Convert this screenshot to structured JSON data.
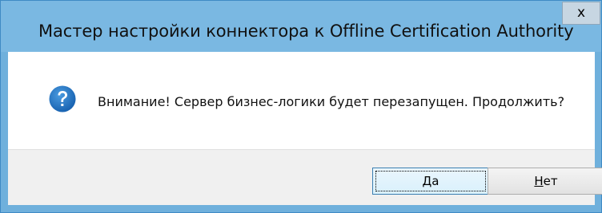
{
  "dialog": {
    "title": "Мастер настройки коннектора к Offline Certification Authority",
    "close_glyph": "x",
    "message": "Внимание! Сервер бизнес-логики будет перезапущен. Продолжить?",
    "icon": "question-icon"
  },
  "buttons": {
    "yes": {
      "accel": "Д",
      "rest": "а"
    },
    "no": {
      "accel": "Н",
      "rest": "ет"
    }
  },
  "colors": {
    "titlebar": "#7ab8e2",
    "icon_blue": "#1f6fc0",
    "button_bar": "#f0f0f0"
  }
}
